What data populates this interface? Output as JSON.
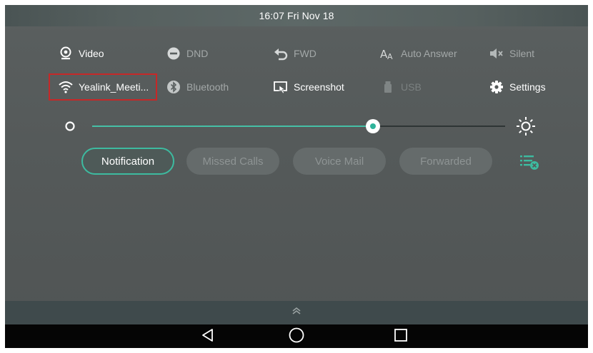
{
  "status_bar": {
    "time": "16:07 Fri Nov 18"
  },
  "quick_settings": {
    "row1": [
      {
        "label": "Video",
        "icon": "video-icon",
        "state": "on"
      },
      {
        "label": "DND",
        "icon": "dnd-icon",
        "state": "off"
      },
      {
        "label": "FWD",
        "icon": "forward-icon",
        "state": "off"
      },
      {
        "label": "Auto Answer",
        "icon": "auto-answer-icon",
        "state": "off"
      },
      {
        "label": "Silent",
        "icon": "silent-icon",
        "state": "off"
      }
    ],
    "row2": [
      {
        "label": "Yealink_Meeti...",
        "icon": "wifi-icon",
        "state": "on"
      },
      {
        "label": "Bluetooth",
        "icon": "bluetooth-icon",
        "state": "off"
      },
      {
        "label": "Screenshot",
        "icon": "screenshot-icon",
        "state": "on"
      },
      {
        "label": "USB",
        "icon": "usb-icon",
        "state": "disabled"
      },
      {
        "label": "Settings",
        "icon": "settings-icon",
        "state": "on"
      }
    ]
  },
  "brightness": {
    "level": 0.68,
    "low_icon": "brightness-low-icon",
    "high_icon": "brightness-high-icon"
  },
  "tabs": [
    {
      "label": "Notification",
      "active": true
    },
    {
      "label": "Missed Calls",
      "active": false
    },
    {
      "label": "Voice Mail",
      "active": false
    },
    {
      "label": "Forwarded",
      "active": false
    }
  ],
  "clear_icon": "clear-notifications-icon",
  "expand_icon": "chevron-up-double-icon",
  "nav": {
    "back": "back-triangle-icon",
    "home": "home-circle-icon",
    "recents": "recents-square-icon"
  },
  "colors": {
    "accent": "#3dbba0",
    "highlight_box": "#c62828",
    "nav_bg": "#050505"
  }
}
